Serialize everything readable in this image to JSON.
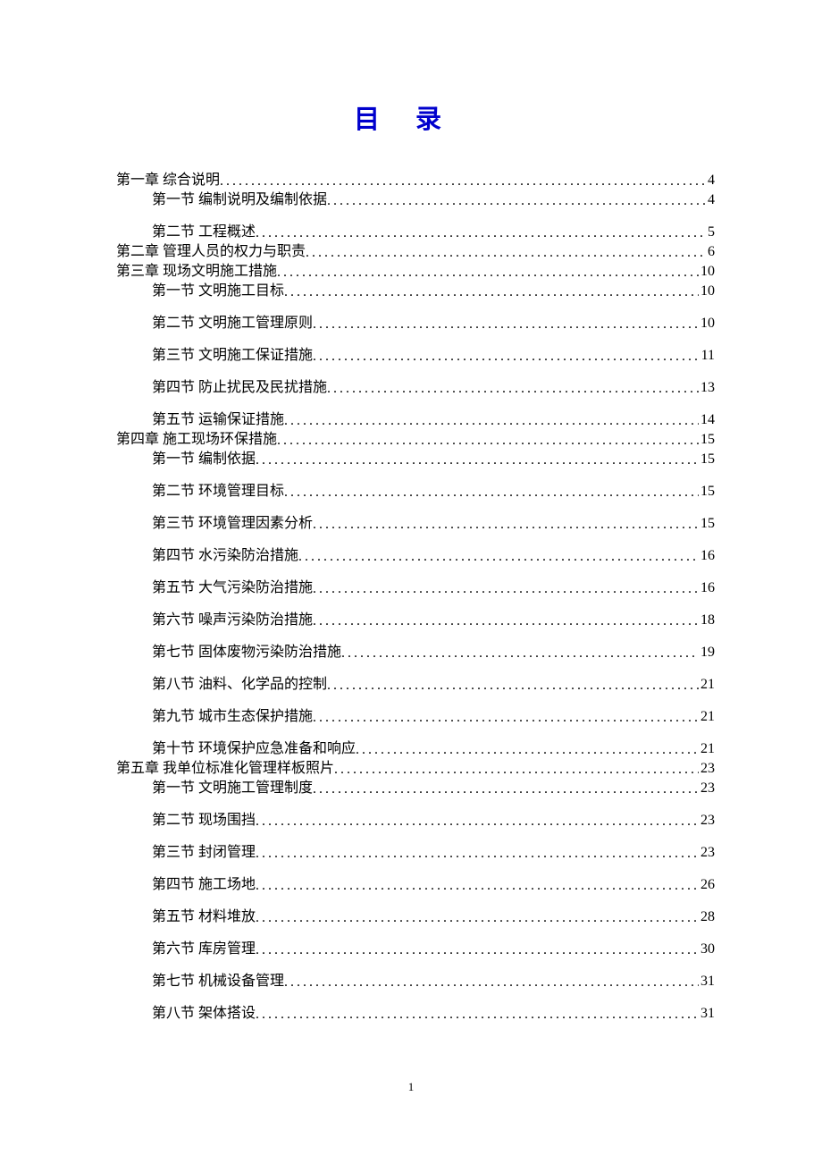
{
  "title": "目录",
  "page_number": "1",
  "toc": [
    {
      "level": "chapter",
      "label": "第一章 综合说明",
      "page": "4"
    },
    {
      "level": "section",
      "label": "第一节 编制说明及编制依据",
      "page": "4"
    },
    {
      "level": "section",
      "label": "第二节 工程概述",
      "page": "5",
      "tight_after": true
    },
    {
      "level": "chapter",
      "label": "第二章 管理人员的权力与职责",
      "page": "6"
    },
    {
      "level": "chapter",
      "label": "第三章 现场文明施工措施",
      "page": "10"
    },
    {
      "level": "section",
      "label": "第一节 文明施工目标",
      "page": "10"
    },
    {
      "level": "section",
      "label": "第二节 文明施工管理原则",
      "page": "10"
    },
    {
      "level": "section",
      "label": "第三节 文明施工保证措施",
      "page": "11"
    },
    {
      "level": "section",
      "label": "第四节 防止扰民及民扰措施",
      "page": "13"
    },
    {
      "level": "section",
      "label": "第五节 运输保证措施",
      "page": "14",
      "tight_after": true
    },
    {
      "level": "chapter",
      "label": "第四章 施工现场环保措施",
      "page": "15"
    },
    {
      "level": "section",
      "label": "第一节 编制依据",
      "page": "15"
    },
    {
      "level": "section",
      "label": "第二节 环境管理目标",
      "page": "15"
    },
    {
      "level": "section",
      "label": "第三节 环境管理因素分析",
      "page": "15"
    },
    {
      "level": "section",
      "label": "第四节 水污染防治措施",
      "page": "16"
    },
    {
      "level": "section",
      "label": "第五节 大气污染防治措施",
      "page": "16"
    },
    {
      "level": "section",
      "label": "第六节 噪声污染防治措施",
      "page": "18"
    },
    {
      "level": "section",
      "label": "第七节 固体废物污染防治措施",
      "page": "19"
    },
    {
      "level": "section",
      "label": "第八节 油料、化学品的控制",
      "page": "21"
    },
    {
      "level": "section",
      "label": "第九节 城市生态保护措施",
      "page": "21"
    },
    {
      "level": "section",
      "label": "第十节 环境保护应急准备和响应",
      "page": "21",
      "tight_after": true
    },
    {
      "level": "chapter",
      "label": "第五章 我单位标准化管理样板照片",
      "page": "23"
    },
    {
      "level": "section",
      "label": "第一节 文明施工管理制度",
      "page": "23"
    },
    {
      "level": "section",
      "label": "第二节 现场围挡",
      "page": "23"
    },
    {
      "level": "section",
      "label": "第三节 封闭管理",
      "page": "23"
    },
    {
      "level": "section",
      "label": "第四节 施工场地",
      "page": "26"
    },
    {
      "level": "section",
      "label": "第五节 材料堆放",
      "page": "28"
    },
    {
      "level": "section",
      "label": "第六节 库房管理",
      "page": "30"
    },
    {
      "level": "section",
      "label": "第七节 机械设备管理",
      "page": "31"
    },
    {
      "level": "section",
      "label": "第八节 架体搭设",
      "page": "31"
    }
  ]
}
